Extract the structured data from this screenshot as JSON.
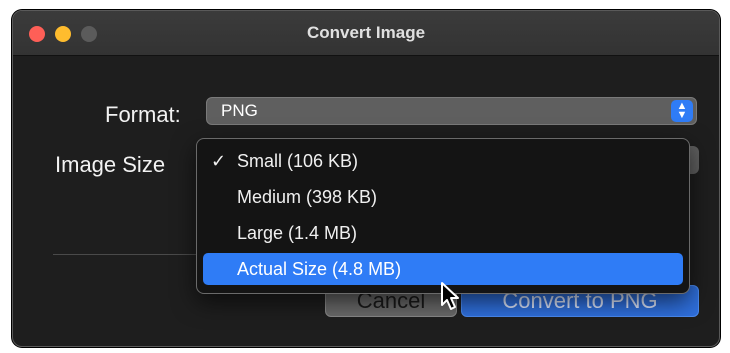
{
  "window": {
    "title": "Convert Image"
  },
  "form": {
    "format_label": "Format:",
    "format_value": "PNG",
    "size_label": "Image Size"
  },
  "menu": {
    "items": [
      {
        "check": "✓",
        "label": "Small (106 KB)"
      },
      {
        "check": "",
        "label": "Medium (398 KB)"
      },
      {
        "check": "",
        "label": "Large (1.4 MB)"
      },
      {
        "check": "",
        "label": "Actual Size (4.8 MB)"
      }
    ],
    "highlighted": "Actual Size (4.8 MB)"
  },
  "buttons": {
    "cancel_label": "Cancel",
    "convert_label": "Convert to PNG"
  },
  "colors": {
    "accent": "#2f7cf6",
    "window_bg": "#1e1e1e"
  }
}
